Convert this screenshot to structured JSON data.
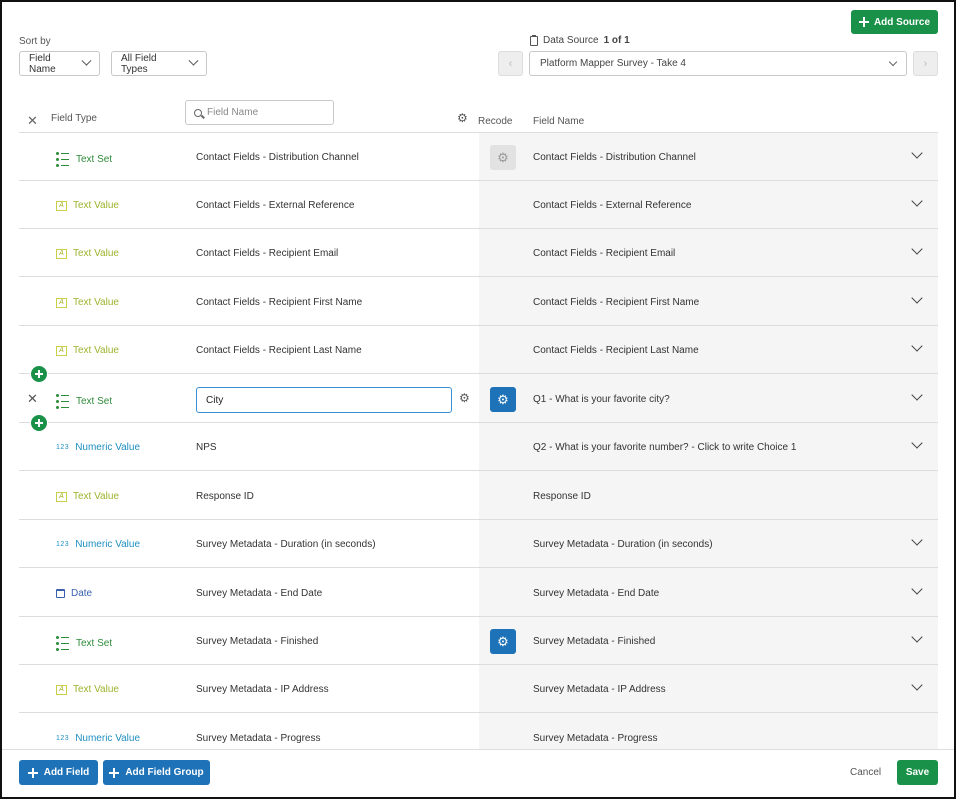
{
  "toolbar": {
    "sort_label": "Sort by",
    "sort_value": "Field Name",
    "type_filter": "All Field Types",
    "add_source": "Add Source"
  },
  "data_source": {
    "label": "Data Source",
    "counter": "1 of 1",
    "selected": "Platform Mapper Survey - Take 4",
    "prev": "‹",
    "next": "›"
  },
  "header": {
    "clear": "✕",
    "field_type": "Field Type",
    "search_placeholder": "Field Name",
    "recode": "Recode",
    "field_name": "Field Name"
  },
  "rows": [
    {
      "type": "Text Set",
      "field": "Contact Fields - Distribution Channel",
      "mapped": "Contact Fields - Distribution Channel"
    },
    {
      "type": "Text Value",
      "field": "Contact Fields - External Reference",
      "mapped": "Contact Fields - External Reference"
    },
    {
      "type": "Text Value",
      "field": "Contact Fields - Recipient Email",
      "mapped": "Contact Fields - Recipient Email"
    },
    {
      "type": "Text Value",
      "field": "Contact Fields - Recipient First Name",
      "mapped": "Contact Fields - Recipient First Name"
    },
    {
      "type": "Text Value",
      "field": "Contact Fields - Recipient Last Name",
      "mapped": "Contact Fields - Recipient Last Name"
    },
    {
      "type": "Text Set",
      "field": "City",
      "mapped": "Q1 - What is your favorite city?"
    },
    {
      "type": "Numeric Value",
      "field": "NPS",
      "mapped": "Q2 - What is your favorite number? - Click to write Choice 1"
    },
    {
      "type": "Text Value",
      "field": "Response ID",
      "mapped": "Response ID"
    },
    {
      "type": "Numeric Value",
      "field": "Survey Metadata - Duration (in seconds)",
      "mapped": "Survey Metadata - Duration (in seconds)"
    },
    {
      "type": "Date",
      "field": "Survey Metadata - End Date",
      "mapped": "Survey Metadata - End Date"
    },
    {
      "type": "Text Set",
      "field": "Survey Metadata - Finished",
      "mapped": "Survey Metadata - Finished"
    },
    {
      "type": "Text Value",
      "field": "Survey Metadata - IP Address",
      "mapped": "Survey Metadata - IP Address"
    },
    {
      "type": "Numeric Value",
      "field": "Survey Metadata - Progress",
      "mapped": "Survey Metadata - Progress"
    }
  ],
  "icons": {
    "text_value": "A",
    "numeric_value": "123",
    "gear": "⚙",
    "close": "✕"
  },
  "footer": {
    "add_field": "Add Field",
    "add_field_group": "Add Field Group",
    "cancel": "Cancel",
    "save": "Save"
  },
  "colors": {
    "primary_green": "#1a9149",
    "primary_blue": "#1d72b8",
    "text_set": "#2e8b3a",
    "text_value": "#9db32c",
    "numeric_value": "#1f8fc0",
    "date": "#3a61b0"
  }
}
